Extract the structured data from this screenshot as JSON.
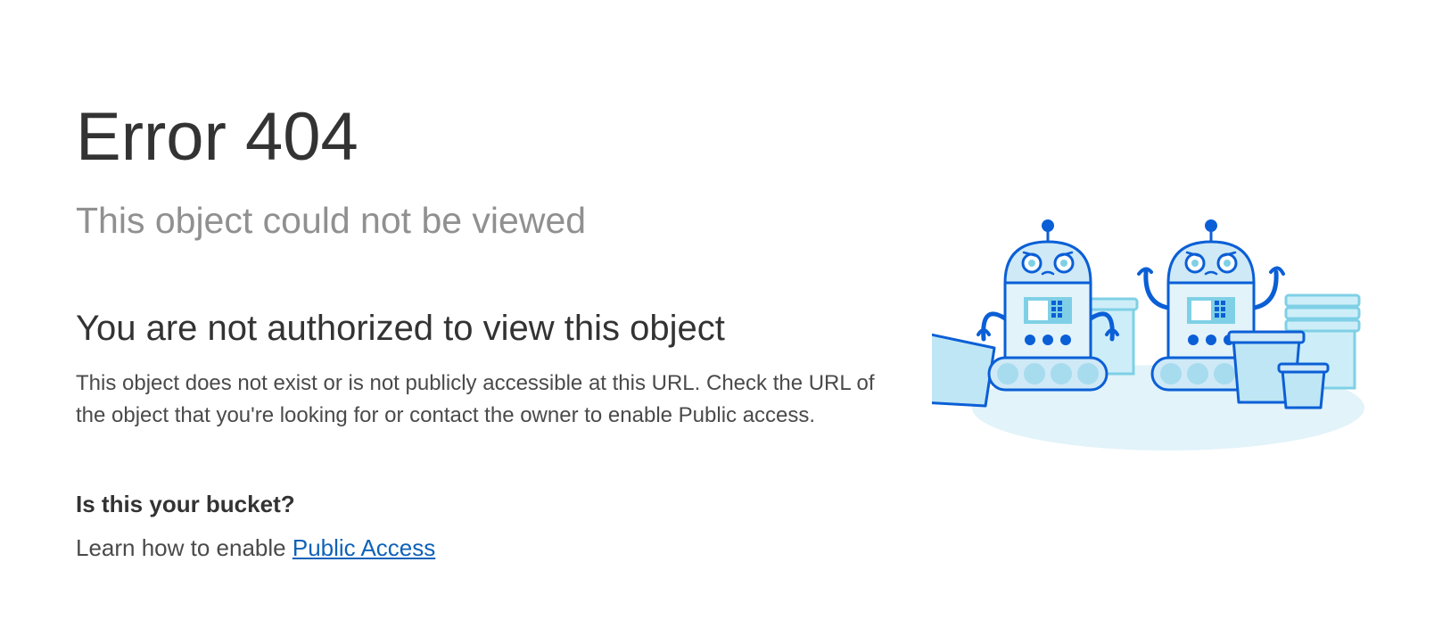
{
  "error": {
    "title": "Error 404",
    "subtitle": "This object could not be viewed"
  },
  "message": {
    "heading": "You are not authorized to view this object",
    "description": "This object does not exist or is not publicly accessible at this URL. Check the URL of the object that you're looking for or contact the owner to enable Public access."
  },
  "help": {
    "heading": "Is this your bucket?",
    "learn_prefix": "Learn how to enable ",
    "link_label": "Public Access"
  },
  "colors": {
    "primary_text": "#333333",
    "muted_text": "#909090",
    "link": "#0f62b8",
    "robot_outline": "#0b5fd6",
    "robot_fill": "#cfe9f7",
    "bucket_fill": "#bfe6f5",
    "shadow_fill": "#e2f3fa"
  },
  "illustration": {
    "icon": "robots-with-buckets-illustration"
  }
}
